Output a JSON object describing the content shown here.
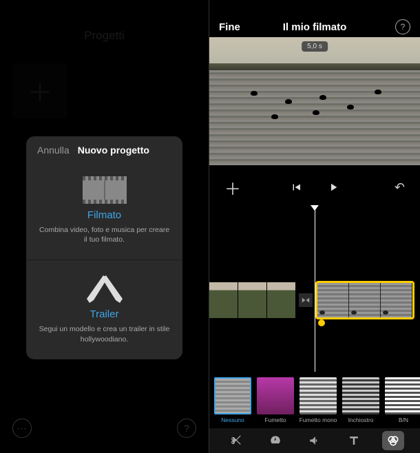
{
  "left": {
    "header": "Progetti",
    "modal": {
      "cancel": "Annulla",
      "title": "Nuovo progetto",
      "options": [
        {
          "title": "Filmato",
          "icon": "filmstrip-icon",
          "desc": "Combina video, foto e musica per creare il tuo filmato."
        },
        {
          "title": "Trailer",
          "icon": "spotlights-icon",
          "desc": "Segui un modello e crea un trailer in stile hollywoodiano."
        }
      ]
    }
  },
  "right": {
    "done": "Fine",
    "title": "Il mio filmato",
    "time_badge": "5,0 s",
    "filters": [
      {
        "label": "Nessuno",
        "class": "f-none",
        "selected": true
      },
      {
        "label": "Fumetto",
        "class": "f-fum",
        "selected": false
      },
      {
        "label": "Fumetto mono",
        "class": "f-mono",
        "selected": false
      },
      {
        "label": "Inchiostro",
        "class": "f-ink",
        "selected": false
      },
      {
        "label": "B/N",
        "class": "f-bn",
        "selected": false
      }
    ],
    "tools": [
      {
        "name": "scissors",
        "active": false
      },
      {
        "name": "speedometer",
        "active": false
      },
      {
        "name": "volume",
        "active": false
      },
      {
        "name": "text",
        "active": false
      },
      {
        "name": "filters",
        "active": true
      }
    ]
  }
}
